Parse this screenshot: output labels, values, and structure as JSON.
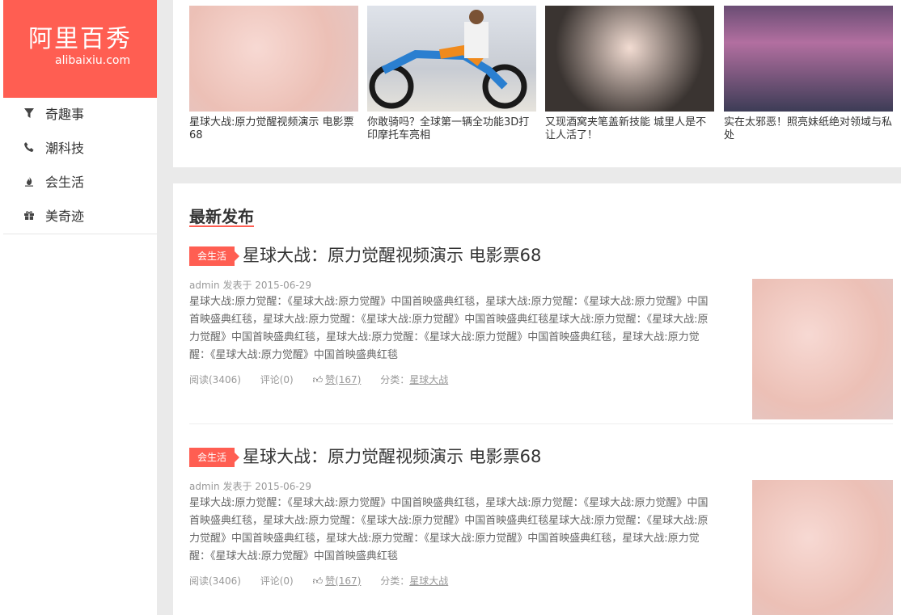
{
  "site": {
    "logo_cn": "阿里百秀",
    "logo_en": "alibaixiu.com",
    "accent": "#ff5e52"
  },
  "nav": [
    {
      "label": "奇趣事",
      "icon": "filter-icon"
    },
    {
      "label": "潮科技",
      "icon": "phone-icon"
    },
    {
      "label": "会生活",
      "icon": "fire-icon"
    },
    {
      "label": "美奇迹",
      "icon": "gift-icon"
    }
  ],
  "thumbs": [
    {
      "caption": "星球大战:原力觉醒视频演示 电影票68"
    },
    {
      "caption": "你敢骑吗？全球第一辆全功能3D打印摩托车亮相"
    },
    {
      "caption": "又现酒窝夹笔盖新技能 城里人是不让人活了！"
    },
    {
      "caption": "实在太邪恶！照亮妹纸绝对领域与私处"
    }
  ],
  "section": {
    "title": "最新发布"
  },
  "articles": [
    {
      "tag": "会生活",
      "title": "星球大战：原力觉醒视频演示 电影票68",
      "author": "admin",
      "published_label": "发表于",
      "date": "2015-06-29",
      "excerpt": "星球大战:原力觉醒：《星球大战:原力觉醒》中国首映盛典红毯，星球大战:原力觉醒：《星球大战:原力觉醒》中国首映盛典红毯，星球大战:原力觉醒：《星球大战:原力觉醒》中国首映盛典红毯星球大战:原力觉醒：《星球大战:原力觉醒》中国首映盛典红毯，星球大战:原力觉醒：《星球大战:原力觉醒》中国首映盛典红毯，星球大战:原力觉醒：《星球大战:原力觉醒》中国首映盛典红毯",
      "reads": "阅读(3406)",
      "comments": "评论(0)",
      "likes": "赞(167)",
      "category_label": "分类：",
      "category": "星球大战"
    },
    {
      "tag": "会生活",
      "title": "星球大战：原力觉醒视频演示 电影票68",
      "author": "admin",
      "published_label": "发表于",
      "date": "2015-06-29",
      "excerpt": "星球大战:原力觉醒：《星球大战:原力觉醒》中国首映盛典红毯，星球大战:原力觉醒：《星球大战:原力觉醒》中国首映盛典红毯，星球大战:原力觉醒：《星球大战:原力觉醒》中国首映盛典红毯星球大战:原力觉醒：《星球大战:原力觉醒》中国首映盛典红毯，星球大战:原力觉醒：《星球大战:原力觉醒》中国首映盛典红毯，星球大战:原力觉醒：《星球大战:原力觉醒》中国首映盛典红毯",
      "reads": "阅读(3406)",
      "comments": "评论(0)",
      "likes": "赞(167)",
      "category_label": "分类：",
      "category": "星球大战"
    }
  ]
}
